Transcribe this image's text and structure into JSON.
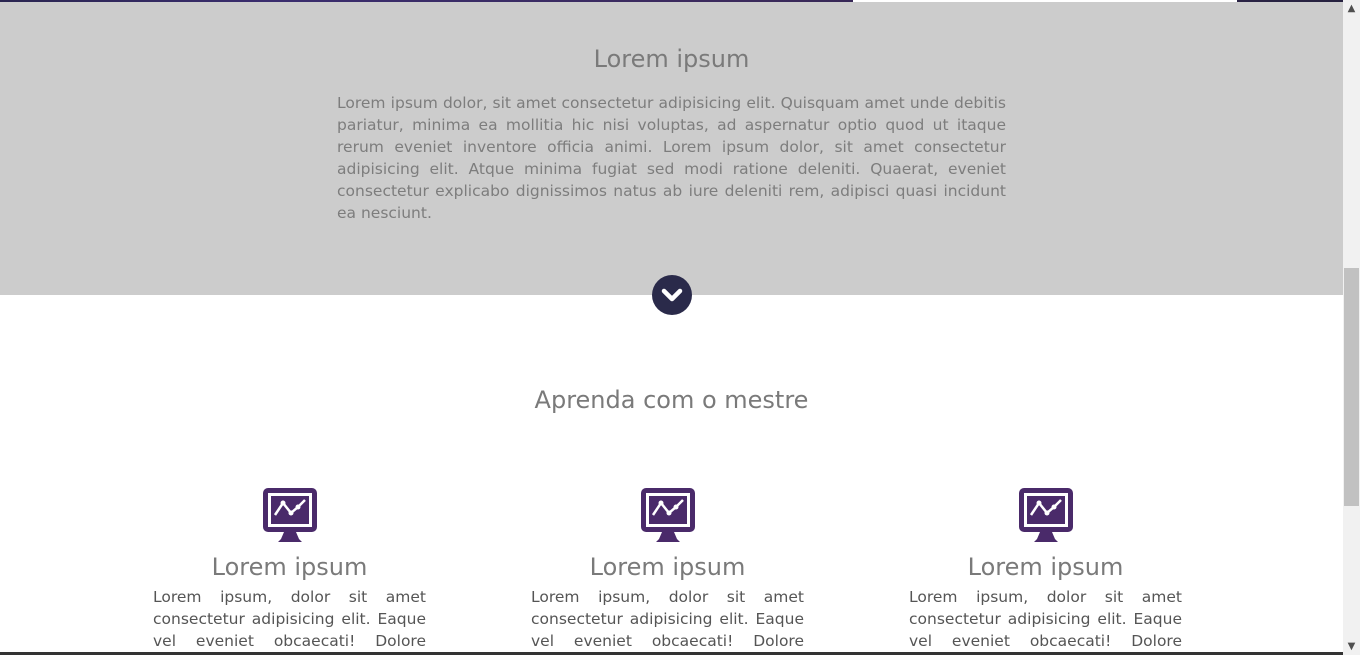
{
  "hero": {
    "title": "Lorem ipsum",
    "text": "Lorem ipsum dolor, sit amet consectetur adipisicing elit. Quisquam amet unde debitis pariatur, minima ea mollitia hic nisi voluptas, ad aspernatur optio quod ut itaque rerum eveniet inventore officia animi. Lorem ipsum dolor, sit amet consectetur adipisicing elit. Atque minima fugiat sed modi ratione deleniti. Quaerat, eveniet consectetur explicabo dignissimos natus ab iure deleniti rem, adipisci quasi incidunt ea nesciunt."
  },
  "scroll_button": {
    "icon": "chevron-down-icon"
  },
  "section": {
    "title": "Aprenda com o mestre"
  },
  "features": [
    {
      "icon": "monitor-chart-icon",
      "title": "Lorem ipsum",
      "text": "Lorem ipsum, dolor sit amet consectetur adipisicing elit. Eaque vel eveniet obcaecati! Dolore"
    },
    {
      "icon": "monitor-chart-icon",
      "title": "Lorem ipsum",
      "text": "Lorem ipsum, dolor sit amet consectetur adipisicing elit. Eaque vel eveniet obcaecati! Dolore"
    },
    {
      "icon": "monitor-chart-icon",
      "title": "Lorem ipsum",
      "text": "Lorem ipsum, dolor sit amet consectetur adipisicing elit. Eaque vel eveniet obcaecati! Dolore"
    }
  ],
  "colors": {
    "gray_band": "#cccccc",
    "icon_purple": "#4a2a6a",
    "button_navy": "#2a2a4a"
  },
  "scrollbar": {
    "up_glyph": "▲",
    "down_glyph": "▼"
  }
}
